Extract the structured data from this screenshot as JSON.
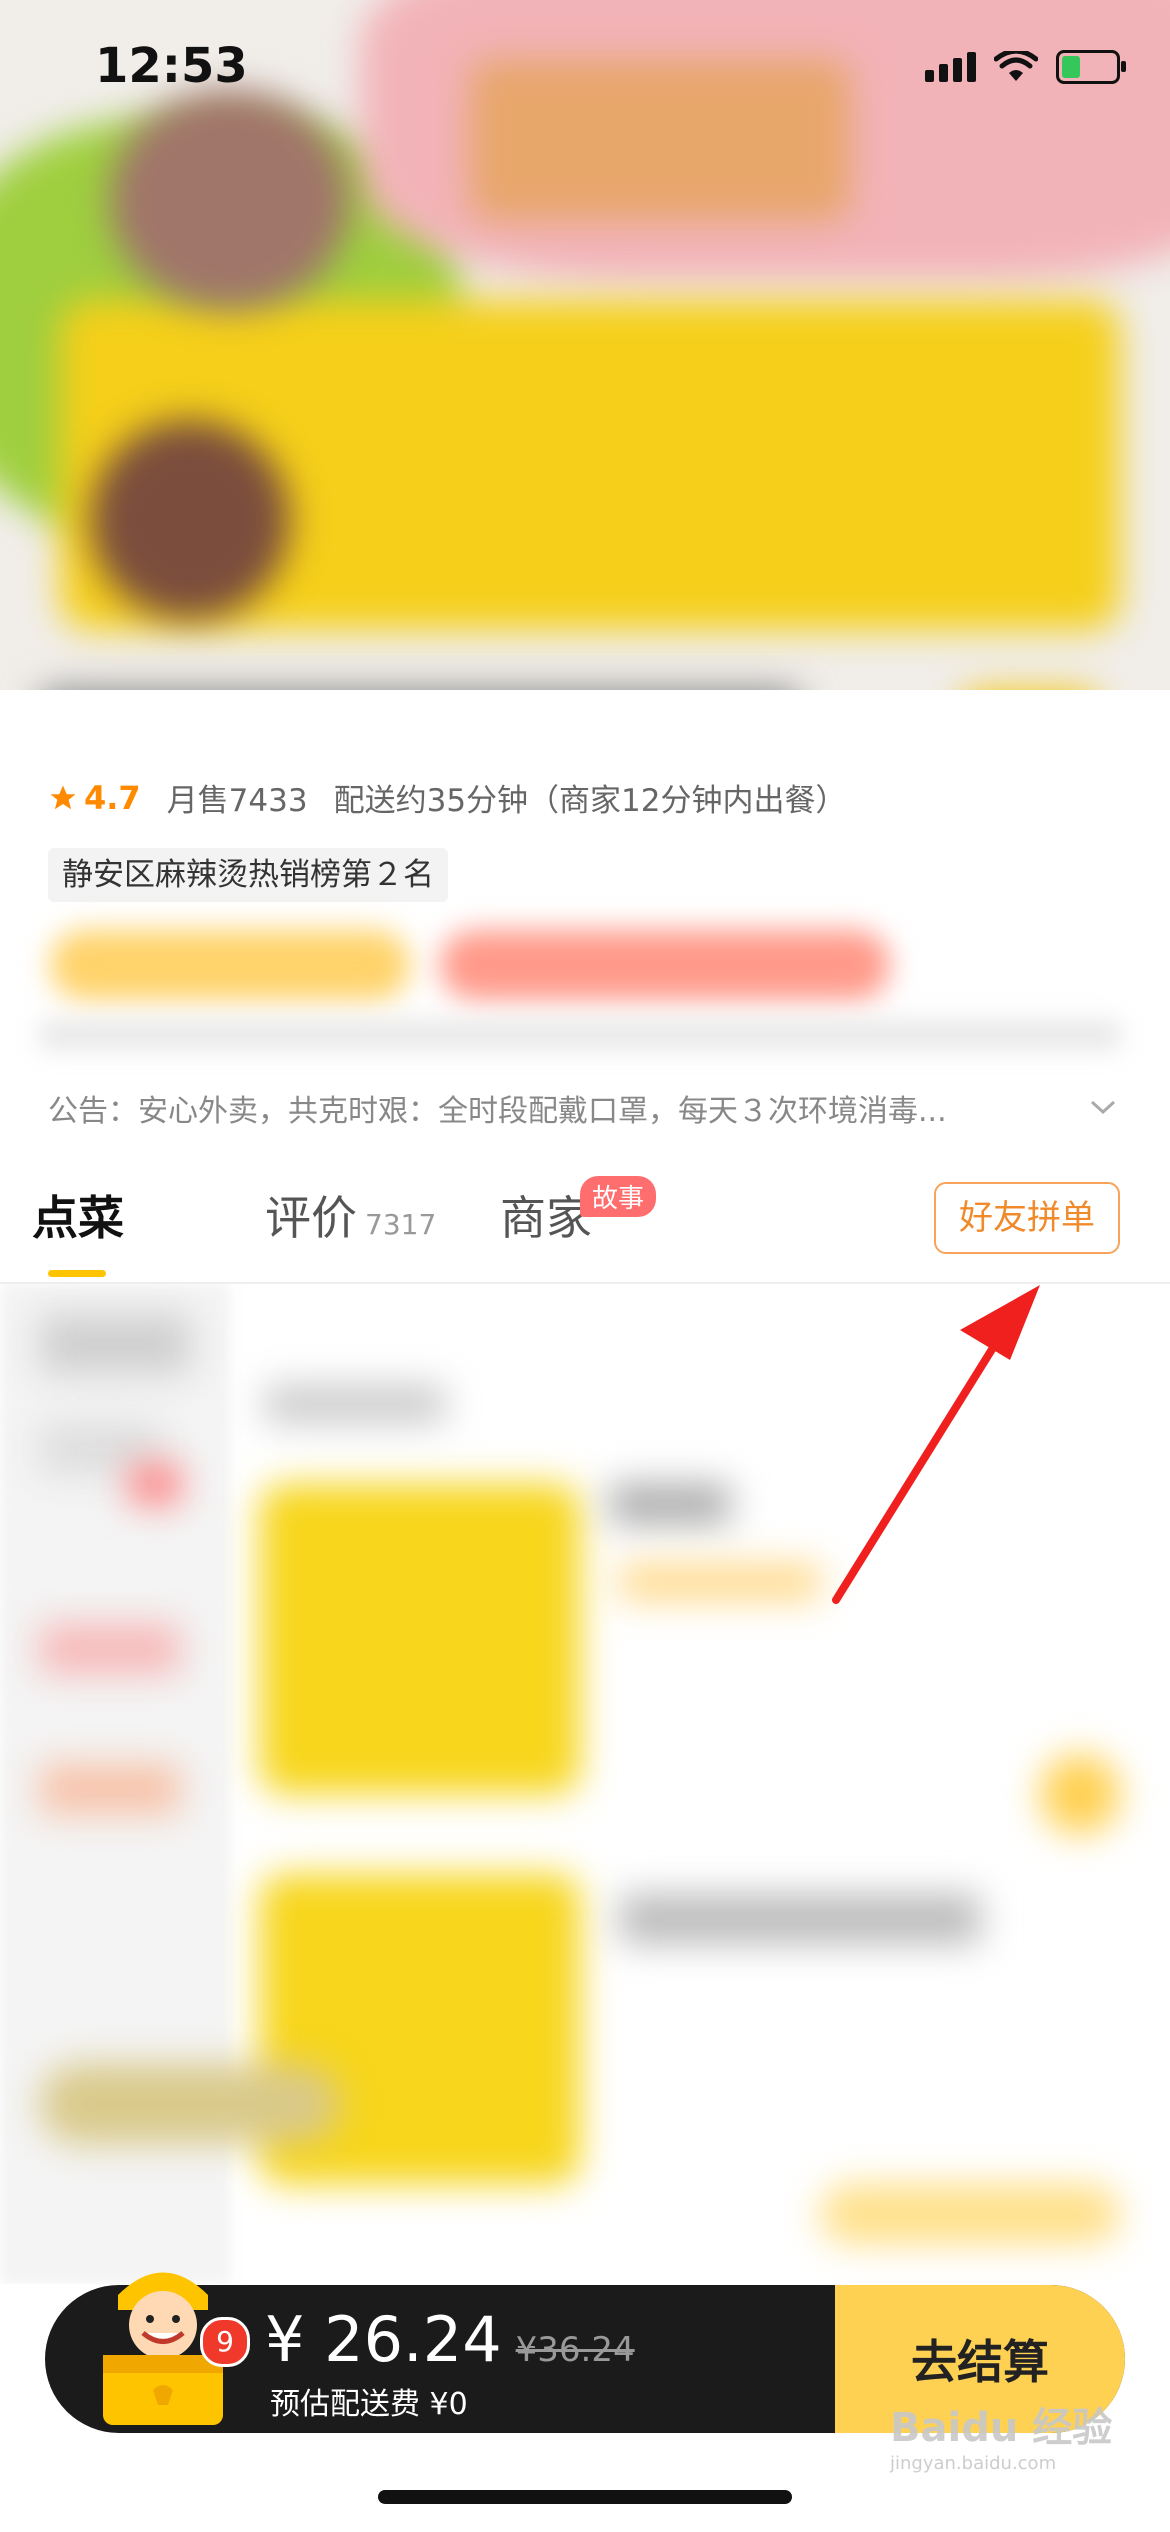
{
  "status_bar": {
    "time": "12:53"
  },
  "shop": {
    "rating": "4.7",
    "monthly_sales": "月售7433",
    "delivery": "配送约35分钟（商家12分钟内出餐）",
    "rank_badge": "静安区麻辣烫热销榜第２名",
    "notice": "公告：安心外卖，共克时艰：全时段配戴口罩，每天３次环境消毒..."
  },
  "tabs": [
    {
      "label": "点菜"
    },
    {
      "label": "评价",
      "count": "7317"
    },
    {
      "label": "商家",
      "badge": "故事"
    }
  ],
  "group_order_label": "好友拼单",
  "cart": {
    "item_count": "9",
    "price": "¥ 26.24",
    "original_price": "¥36.24",
    "delivery_fee": "预估配送费 ¥0",
    "checkout_label": "去结算"
  },
  "watermark": {
    "logo": "Baidu 经验",
    "url": "jingyan.baidu.com"
  },
  "colors": {
    "accent": "#ffc400",
    "orange": "#f08a2a",
    "red": "#f0382b",
    "checkout": "#ffd153",
    "cart_bg": "#1b1b1b"
  }
}
